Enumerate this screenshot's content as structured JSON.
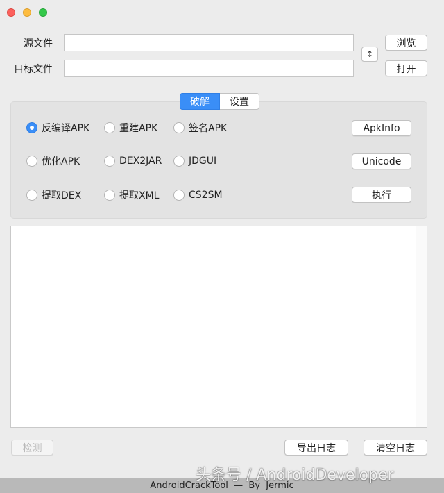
{
  "source_file": {
    "label": "源文件",
    "value": ""
  },
  "target_file": {
    "label": "目标文件",
    "value": ""
  },
  "buttons": {
    "browse": "浏览",
    "open": "打开",
    "swap_glyph": "↕",
    "apkinfo": "ApkInfo",
    "unicode": "Unicode",
    "execute": "执行",
    "detect": "检测",
    "export_log": "导出日志",
    "clear_log": "清空日志"
  },
  "tabs": {
    "crack": "破解",
    "settings": "设置",
    "active": "crack"
  },
  "options": {
    "decompile_apk": "反编译APK",
    "rebuild_apk": "重建APK",
    "sign_apk": "签名APK",
    "optimize_apk": "优化APK",
    "dex2jar": "DEX2JAR",
    "jdgui": "JDGUI",
    "extract_dex": "提取DEX",
    "extract_xml": "提取XML",
    "cs2sm": "CS2SM",
    "selected": "decompile_apk"
  },
  "log": {
    "content": ""
  },
  "status_bar": {
    "text": "AndroidCrackTool  —  By  Jermic"
  },
  "watermark": {
    "text": "头条号 / AndroidDeveloper"
  },
  "colors": {
    "accent": "#3a8ef7",
    "background": "#ececec",
    "panel": "#e3e3e3"
  }
}
